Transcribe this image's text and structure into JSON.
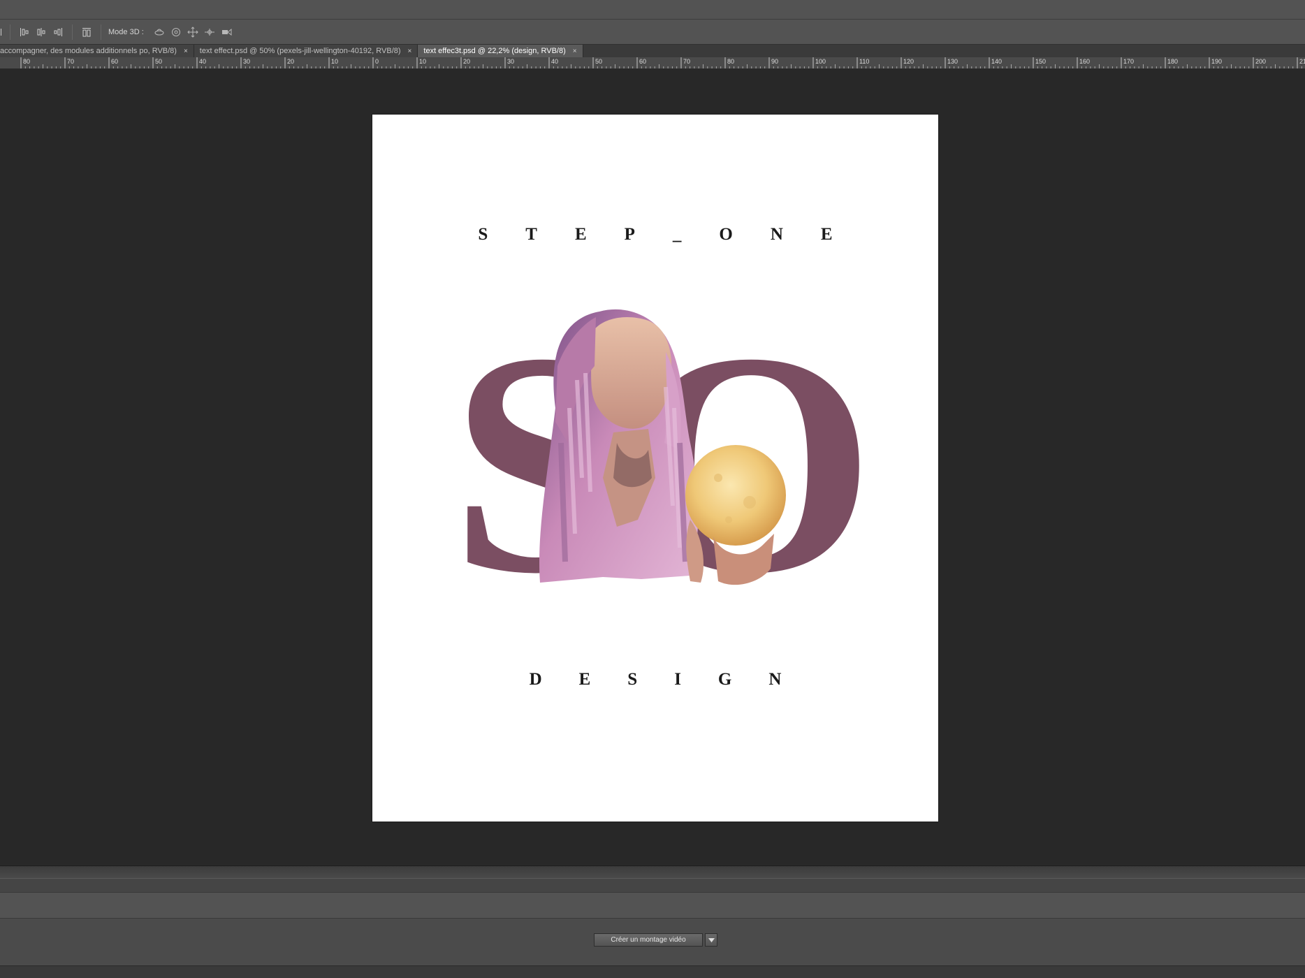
{
  "options_bar": {
    "mode3d_label": "Mode 3D :",
    "align_icons": [
      "align-left-icon",
      "align-hcenter-icon",
      "align-right-icon",
      "distribute-icon"
    ],
    "mode3d_icons": [
      "rotate-3d-icon",
      "roll-3d-icon",
      "pan-3d-icon",
      "slide-3d-icon",
      "scale-3d-icon"
    ]
  },
  "tabs": [
    {
      "label": "accompagner, des modules additionnels po, RVB/8)",
      "close": "×",
      "active": false
    },
    {
      "label": "text effect.psd @ 50% (pexels-jill-wellington-40192, RVB/8)",
      "close": "×",
      "active": false
    },
    {
      "label": "text effec3t.psd @ 22,2% (design, RVB/8)",
      "close": "×",
      "active": true
    }
  ],
  "ruler": {
    "labels": [
      "80",
      "70",
      "60",
      "50",
      "40",
      "30",
      "20",
      "10",
      "0",
      "10",
      "20",
      "30",
      "40",
      "50",
      "60",
      "70",
      "80",
      "90",
      "100",
      "110",
      "120",
      "130",
      "140",
      "150",
      "160",
      "170",
      "180",
      "190",
      "200",
      "21"
    ]
  },
  "document": {
    "title_top": "STEP_ONE",
    "title_bottom": "DESIGN",
    "monogram": "SO",
    "monogram_color": "#7b4e62",
    "background": "#ffffff"
  },
  "timeline": {
    "create_video_button": "Créer un montage vidéo"
  },
  "colors": {
    "app_bg": "#282828",
    "panel_bg": "#535353",
    "active_tab": "#5a5a5a"
  }
}
